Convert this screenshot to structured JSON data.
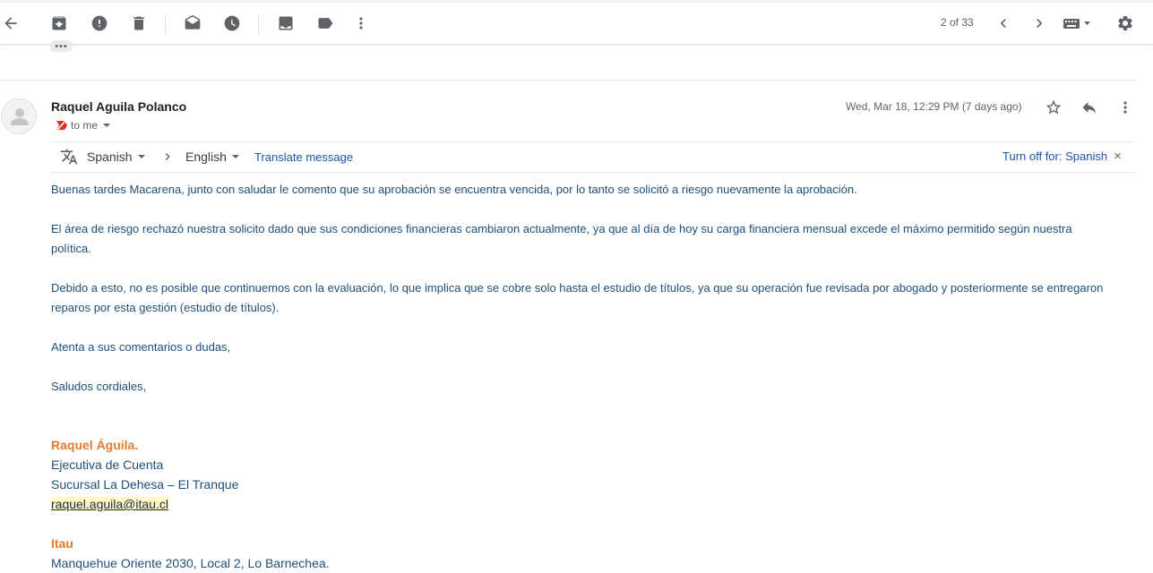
{
  "toolbar": {
    "icons": [
      "back-arrow-icon",
      "archive-icon",
      "report-spam-icon",
      "delete-icon",
      "mark-unread-icon",
      "snooze-icon",
      "move-to-icon",
      "label-icon",
      "more-vert-icon"
    ],
    "pager": "2 of 33"
  },
  "thread": {
    "collapsed_indicator": "•••"
  },
  "message": {
    "sender": "Raquel Aguila Polanco",
    "recipient_label": "to me",
    "date": "Wed, Mar 18, 12:29 PM (7 days ago)"
  },
  "translate": {
    "source_lang": "Spanish",
    "target_lang": "English",
    "translate_link": "Translate message",
    "turn_off": "Turn off for: Spanish"
  },
  "body": {
    "p1": "Buenas tardes Macarena, junto con saludar le comento que su aprobación se encuentra vencida, por lo tanto se solicitó a riesgo nuevamente la aprobación.",
    "p2": "El área de riesgo rechazó nuestra solicito dado que sus condiciones financieras cambiaron actualmente, ya que al día de hoy su carga financiera mensual excede el máximo permitido según nuestra política.",
    "p3": "Debido a esto, no es posible que continuemos con la evaluación, lo que implica que se cobre solo hasta el estudio de títulos, ya que su operación fue revisada por abogado y posteriormente se entregaron reparos por esta gestión (estudio de títulos).",
    "p4": "Atenta a sus comentarios o dudas,",
    "p5": "Saludos cordiales,"
  },
  "signature": {
    "name": "Raquel Águila.",
    "title": "Ejecutiva de Cuenta",
    "branch": "Sucursal La Dehesa – El Tranque",
    "email": "raquel.aguila@itau.cl",
    "company": "Itau",
    "address": "Manquehue Oriente 2030, Local 2, Lo Barnechea."
  },
  "colors": {
    "body_text": "#1f4e79",
    "signature_accent": "#e07b2e",
    "link": "#1a56b0"
  }
}
